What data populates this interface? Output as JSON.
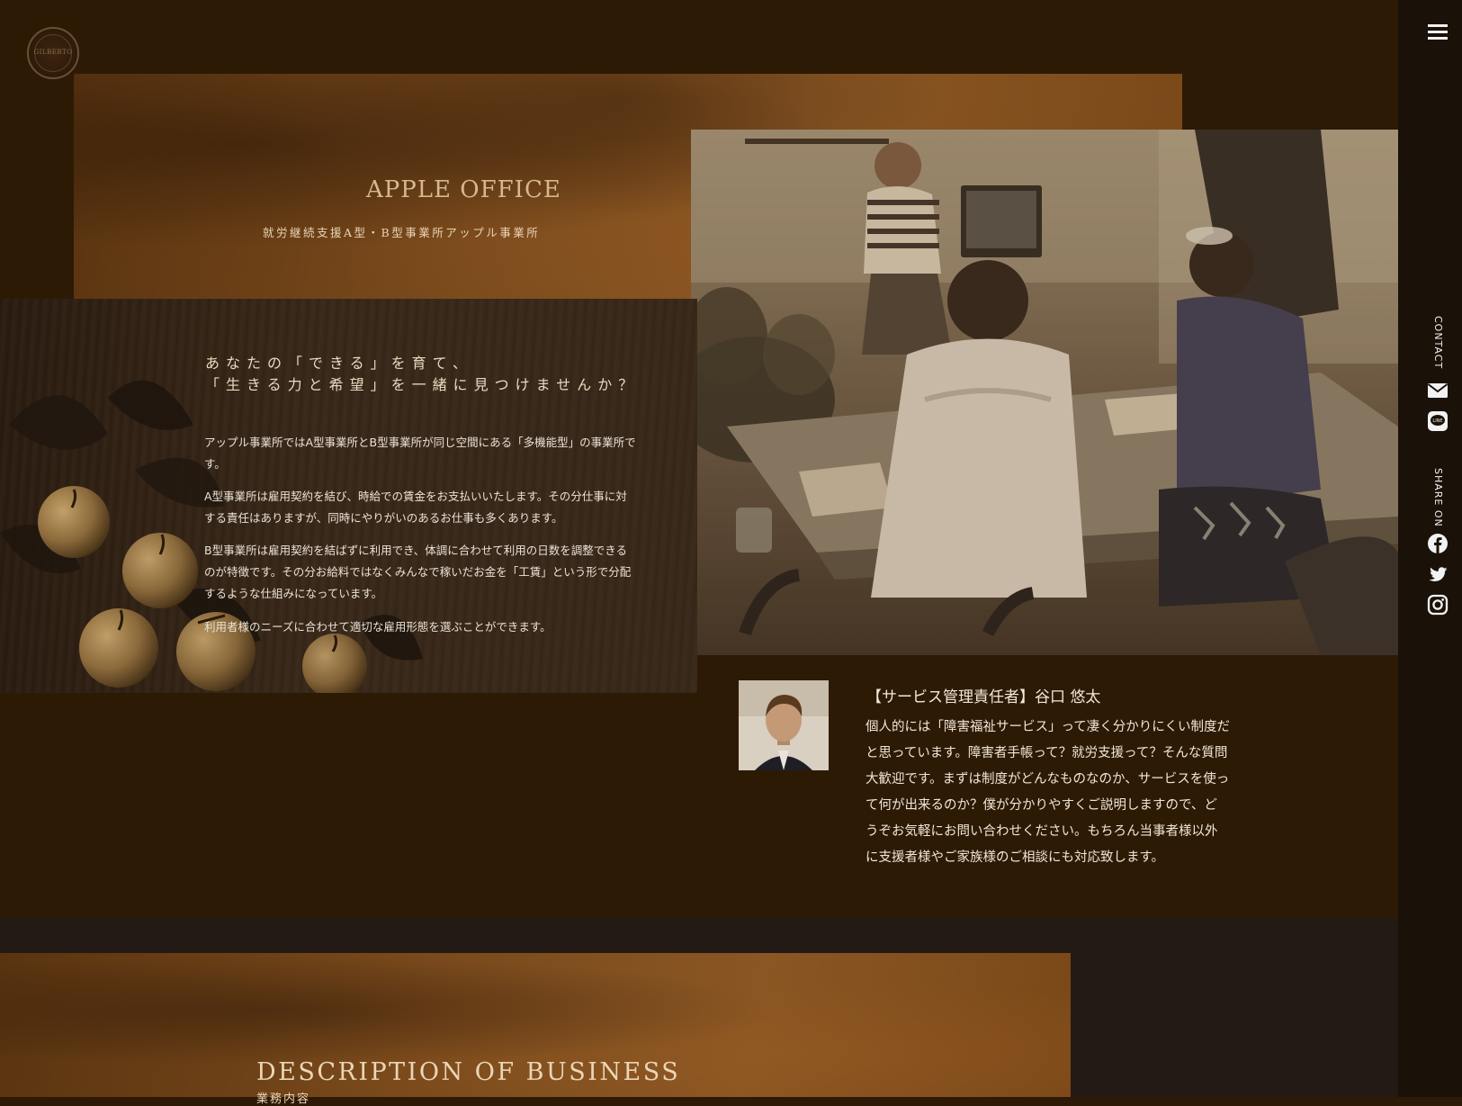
{
  "logo": {
    "text": "GILBERTO"
  },
  "hero": {
    "title": "APPLE OFFICE",
    "subtitle": "就労継続支援A型・B型事業所アップル事業所"
  },
  "intro": {
    "heading_line1": "あなたの「できる」を育て、",
    "heading_line2": "「生きる力と希望」を一緒に見つけませんか？",
    "paragraphs": [
      "アップル事業所ではA型事業所とB型事業所が同じ空間にある「多機能型」の事業所です。",
      "A型事業所は雇用契約を結び、時給での賃金をお支払いいたします。その分仕事に対する責任はありますが、同時にやりがいのあるお仕事も多くあります。",
      "B型事業所は雇用契約を結ばずに利用でき、体調に合わせて利用の日数を調整できるのが特徴です。その分お給料ではなくみんなで稼いだお金を「工賃」という形で分配するような仕組みになっています。",
      "利用者様のニーズに合わせて適切な雇用形態を選ぶことができます。"
    ]
  },
  "manager": {
    "title": "【サービス管理責任者】谷口 悠太",
    "message": "個人的には「障害福祉サービス」って凄く分かりにくい制度だと思っています。障害者手帳って？就労支援って？そんな質問大歓迎です。まずは制度がどんなものなのか、サービスを使って何が出来るのか？僕が分かりやすくご説明しますので、どうぞお気軽にお問い合わせください。もちろん当事者様以外に支援者様やご家族様のご相談にも対応致します。"
  },
  "business": {
    "title": "DESCRIPTION OF BUSINESS",
    "subtitle": "業務内容"
  },
  "sidebar": {
    "contact_label": "CONTACT",
    "share_label": "SHARE ON",
    "icons": [
      "mail-icon",
      "line-icon",
      "facebook-icon",
      "twitter-icon",
      "instagram-icon"
    ]
  },
  "colors": {
    "background": "#2d1a05",
    "panel_brown": "#7a4a1c",
    "sidebar": "#1a1108",
    "bottom_band": "#241a15",
    "accent_text": "#d5b88f"
  }
}
